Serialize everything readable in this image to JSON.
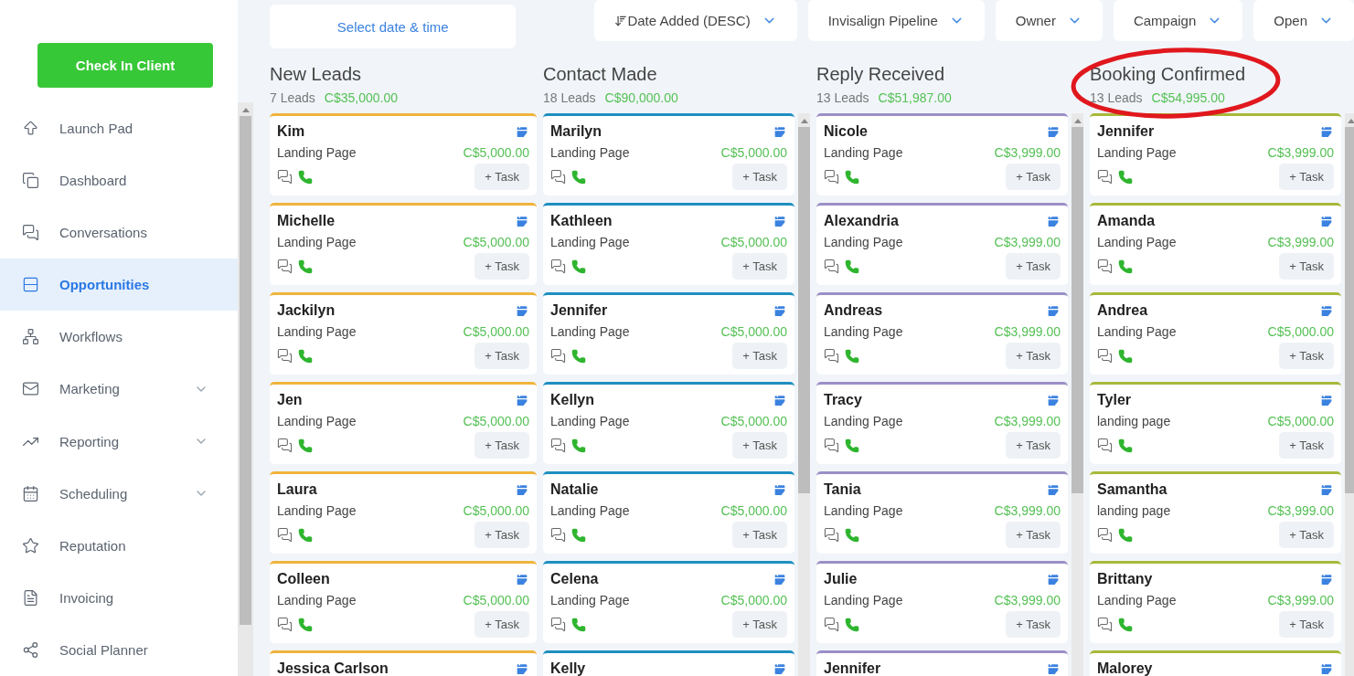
{
  "sidebar": {
    "check_in_button": "Check In Client",
    "items": [
      {
        "label": "Launch Pad",
        "selected": false,
        "submenu": false
      },
      {
        "label": "Dashboard",
        "selected": false,
        "submenu": false
      },
      {
        "label": "Conversations",
        "selected": false,
        "submenu": false
      },
      {
        "label": "Opportunities",
        "selected": true,
        "submenu": false
      },
      {
        "label": "Workflows",
        "selected": false,
        "submenu": false
      },
      {
        "label": "Marketing",
        "selected": false,
        "submenu": true
      },
      {
        "label": "Reporting",
        "selected": false,
        "submenu": true
      },
      {
        "label": "Scheduling",
        "selected": false,
        "submenu": true
      },
      {
        "label": "Reputation",
        "selected": false,
        "submenu": false
      },
      {
        "label": "Invoicing",
        "selected": false,
        "submenu": false
      },
      {
        "label": "Social Planner",
        "selected": false,
        "submenu": false
      }
    ]
  },
  "toolbar": {
    "date_field": {
      "placeholder": "Select date & time"
    },
    "filters": [
      {
        "label": "Date Added (DESC)",
        "kind": "sort"
      },
      {
        "label": "Invisalign Pipeline",
        "kind": "dropdown"
      },
      {
        "label": "Owner",
        "kind": "dropdown"
      },
      {
        "label": "Campaign",
        "kind": "dropdown"
      },
      {
        "label": "Open",
        "kind": "dropdown"
      }
    ]
  },
  "columns": [
    {
      "title": "New Leads",
      "count": "7 Leads",
      "total": "C$35,000.00",
      "color": "#f0b43c",
      "cards": [
        {
          "name": "Kim",
          "source": "Landing Page",
          "value": "C$5,000.00",
          "task": "+ Task"
        },
        {
          "name": "Michelle",
          "source": "Landing Page",
          "value": "C$5,000.00",
          "task": "+ Task"
        },
        {
          "name": "Jackilyn",
          "source": "Landing Page",
          "value": "C$5,000.00",
          "task": "+ Task"
        },
        {
          "name": "Jen",
          "source": "Landing Page",
          "value": "C$5,000.00",
          "task": "+ Task"
        },
        {
          "name": "Laura",
          "source": "Landing Page",
          "value": "C$5,000.00",
          "task": "+ Task"
        },
        {
          "name": "Colleen",
          "source": "Landing Page",
          "value": "C$5,000.00",
          "task": "+ Task"
        },
        {
          "name": "Jessica Carlson"
        }
      ]
    },
    {
      "title": "Contact Made",
      "count": "18 Leads",
      "total": "C$90,000.00",
      "color": "#1e8fc0",
      "cards": [
        {
          "name": "Marilyn",
          "source": "Landing Page",
          "value": "C$5,000.00",
          "task": "+ Task"
        },
        {
          "name": "Kathleen",
          "source": "Landing Page",
          "value": "C$5,000.00",
          "task": "+ Task"
        },
        {
          "name": "Jennifer",
          "source": "Landing Page",
          "value": "C$5,000.00",
          "task": "+ Task"
        },
        {
          "name": "Kellyn",
          "source": "Landing Page",
          "value": "C$5,000.00",
          "task": "+ Task"
        },
        {
          "name": "Natalie",
          "source": "Landing Page",
          "value": "C$5,000.00",
          "task": "+ Task"
        },
        {
          "name": "Celena",
          "source": "Landing Page",
          "value": "C$5,000.00",
          "task": "+ Task"
        },
        {
          "name": "Kelly"
        }
      ]
    },
    {
      "title": "Reply Received",
      "count": "13 Leads",
      "total": "C$51,987.00",
      "color": "#9b8fc7",
      "cards": [
        {
          "name": "Nicole",
          "source": "Landing Page",
          "value": "C$3,999.00",
          "task": "+ Task"
        },
        {
          "name": "Alexandria",
          "source": "Landing Page",
          "value": "C$3,999.00",
          "task": "+ Task"
        },
        {
          "name": "Andreas",
          "source": "Landing Page",
          "value": "C$3,999.00",
          "task": "+ Task"
        },
        {
          "name": "Tracy",
          "source": "Landing Page",
          "value": "C$3,999.00",
          "task": "+ Task"
        },
        {
          "name": "Tania",
          "source": "Landing Page",
          "value": "C$3,999.00",
          "task": "+ Task"
        },
        {
          "name": "Julie",
          "source": "Landing Page",
          "value": "C$3,999.00",
          "task": "+ Task"
        },
        {
          "name": "Jennifer"
        }
      ]
    },
    {
      "title": "Booking Confirmed",
      "count": "13 Leads",
      "total": "C$54,995.00",
      "color": "#a8b83a",
      "circled": true,
      "cards": [
        {
          "name": "Jennifer",
          "source": "Landing Page",
          "value": "C$3,999.00",
          "task": "+ Task"
        },
        {
          "name": "Amanda",
          "source": "Landing Page",
          "value": "C$3,999.00",
          "task": "+ Task"
        },
        {
          "name": "Andrea",
          "source": "Landing Page",
          "value": "C$5,000.00",
          "task": "+ Task"
        },
        {
          "name": "Tyler",
          "source": "landing page",
          "value": "C$5,000.00",
          "task": "+ Task"
        },
        {
          "name": "Samantha",
          "source": "landing page",
          "value": "C$3,999.00",
          "task": "+ Task"
        },
        {
          "name": "Brittany",
          "source": "Landing Page",
          "value": "C$3,999.00",
          "task": "+ Task"
        },
        {
          "name": "Malorey"
        }
      ]
    }
  ]
}
